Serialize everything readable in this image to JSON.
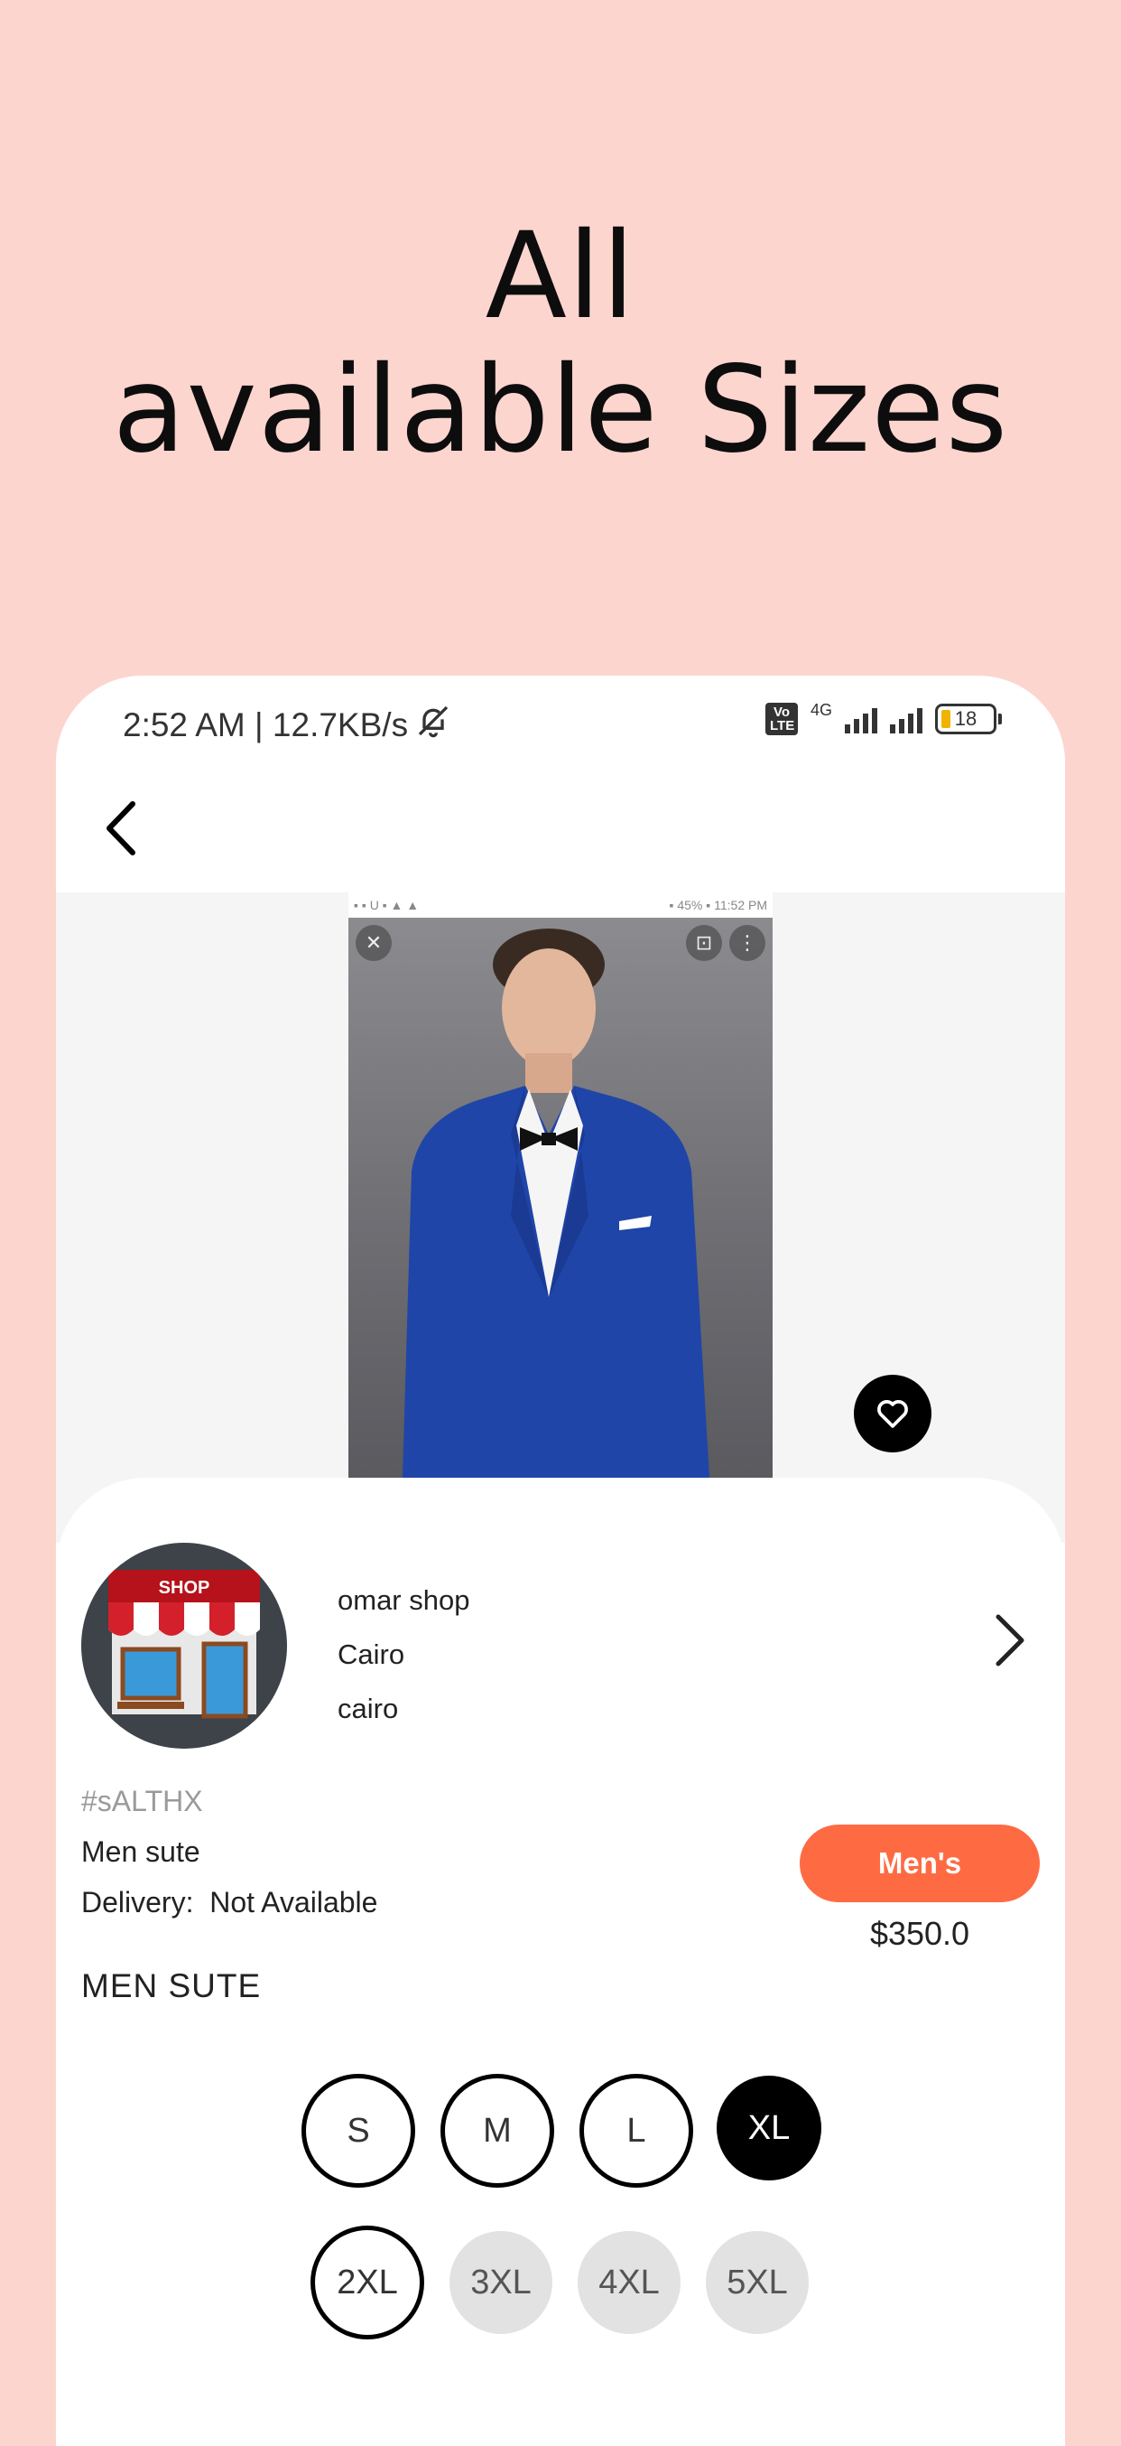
{
  "headline": {
    "line1": "All",
    "line2": "available Sizes"
  },
  "status_bar": {
    "time_speed": "2:52 AM | 12.7KB/s",
    "volte": "Vo LTE",
    "network": "4G",
    "battery": "18"
  },
  "product_image": {
    "inner_status_left": "▪ ▪ U ▪ ▲ ▲",
    "inner_status_right": "▪ 45% ▪ 11:52 PM"
  },
  "shop": {
    "sign": "SHOP",
    "name": "omar shop",
    "city": "Cairo",
    "area": "cairo"
  },
  "product": {
    "code": "#sALTHX",
    "name": "Men sute",
    "delivery": "Delivery:  Not Available",
    "category": "Men's",
    "price": "$350.0",
    "section_title": "MEN SUTE"
  },
  "sizes": [
    "S",
    "M",
    "L",
    "XL",
    "2XL",
    "3XL",
    "4XL",
    "5XL"
  ],
  "colors": {
    "background": "#fdd5cf",
    "accent": "#fe6b43",
    "selected": "#000000",
    "unavailable": "#e2e2e2"
  },
  "icons": [
    "back-arrow-icon",
    "close-icon",
    "scan-icon",
    "more-vertical-icon",
    "heart-icon",
    "chevron-right-icon",
    "bell-off-icon"
  ]
}
